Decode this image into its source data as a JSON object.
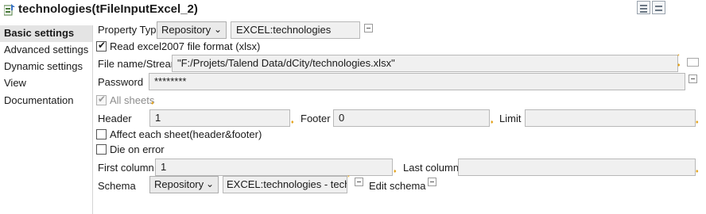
{
  "header": {
    "title": "technologies(tFileInputExcel_2)",
    "icon": "excel-component-icon",
    "view_buttons": [
      "grid-view-icon",
      "list-view-icon"
    ]
  },
  "sidebar": {
    "items": [
      {
        "label": "Basic settings",
        "active": true
      },
      {
        "label": "Advanced settings",
        "active": false
      },
      {
        "label": "Dynamic settings",
        "active": false
      },
      {
        "label": "View",
        "active": false
      },
      {
        "label": "Documentation",
        "active": false
      }
    ]
  },
  "form": {
    "property_type": {
      "label": "Property Type",
      "value": "Repository",
      "repo": "EXCEL:technologies"
    },
    "read_excel2007": {
      "label": "Read excel2007 file format (xlsx)",
      "checked": true
    },
    "file_name": {
      "label": "File name/Stream",
      "value": "\"F:/Projets/Talend Data/dCity/technologies.xlsx\""
    },
    "password": {
      "label": "Password",
      "value": "********"
    },
    "all_sheets": {
      "label": "All sheets",
      "checked": true,
      "disabled": true
    },
    "header": {
      "label": "Header",
      "value": "1"
    },
    "footer": {
      "label": "Footer",
      "value": "0"
    },
    "limit": {
      "label": "Limit",
      "value": ""
    },
    "affect_each_sheet": {
      "label": "Affect each sheet(header&footer)",
      "checked": false
    },
    "die_on_error": {
      "label": "Die on error",
      "checked": false
    },
    "first_column": {
      "label": "First column",
      "value": "1"
    },
    "last_column": {
      "label": "Last column",
      "value": ""
    },
    "schema": {
      "label": "Schema",
      "value": "Repository",
      "repo": "EXCEL:technologies - techno",
      "edit_label": "Edit schema"
    }
  },
  "colors": {
    "accent_marker": "#e3a21a",
    "active_tab": "#e4e4e4"
  }
}
